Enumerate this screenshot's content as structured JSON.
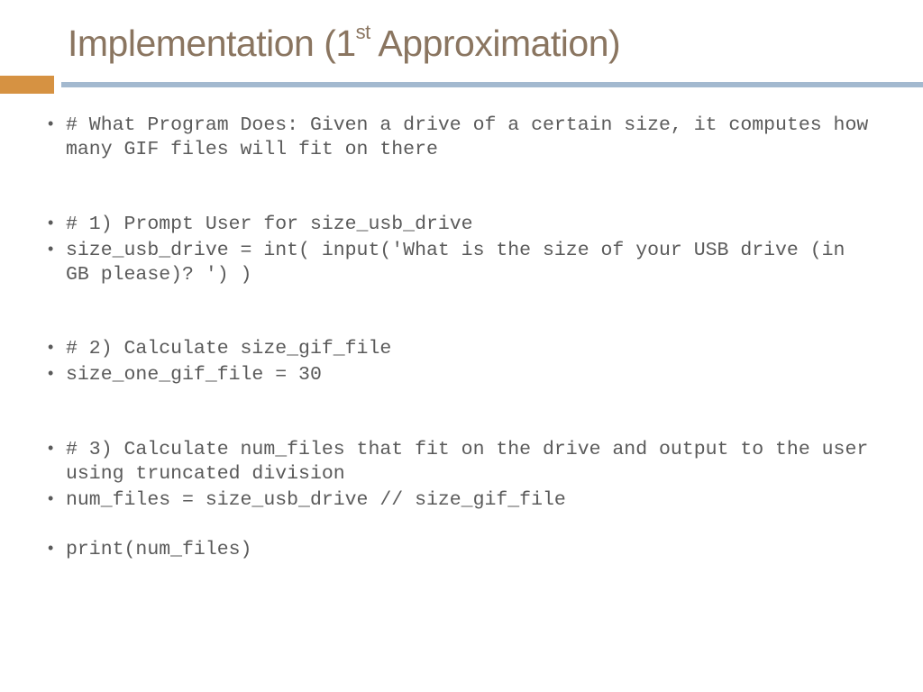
{
  "title": {
    "pre": "Implementation (1",
    "sup": "st",
    "post": " Approximation)"
  },
  "bullets": {
    "b0": "# What Program Does: Given a drive of a certain size, it computes how many GIF files will fit on there",
    "b1": "# 1) Prompt User for size_usb_drive",
    "b2": "size_usb_drive = int( input('What is the size of your USB drive (in GB please)?  ') )",
    "b3": "# 2) Calculate size_gif_file",
    "b4": "size_one_gif_file = 30",
    "b5": "# 3) Calculate num_files that fit on the drive and output to the user using truncated division",
    "b6": "num_files = size_usb_drive // size_gif_file",
    "b7": "print(num_files)"
  },
  "colors": {
    "title": "#8a7560",
    "accent": "#d69242",
    "divider": "#a3b9cf",
    "text": "#5a5a5a"
  }
}
